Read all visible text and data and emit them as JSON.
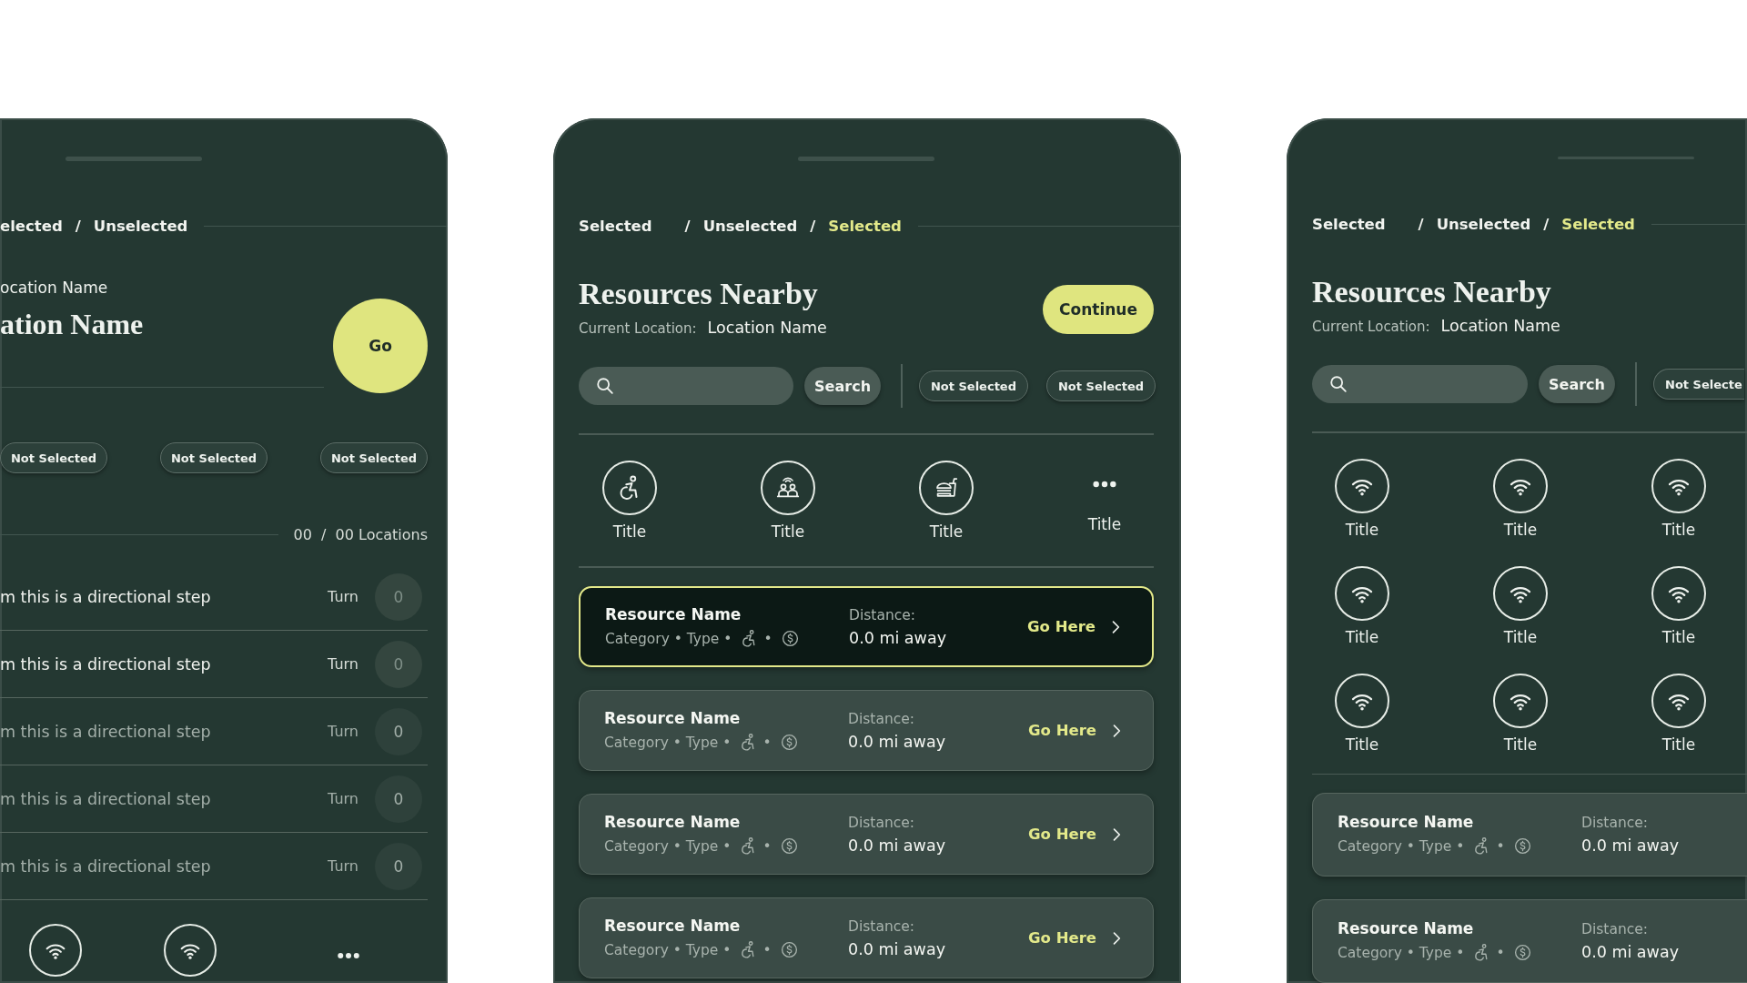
{
  "screens": [
    {
      "kind": "directions",
      "breadcrumb": [
        {
          "kind": "crumb",
          "label": "elected",
          "selected": false
        },
        {
          "kind": "separator",
          "label": "/"
        },
        {
          "kind": "crumb",
          "label": "Unselected",
          "selected": false
        }
      ],
      "location_label": "ocation Name",
      "title": "ation Name",
      "go_button": "Go",
      "filters": [
        {
          "label": "Not Selected",
          "selected": false
        },
        {
          "label": "Not Selected",
          "selected": false
        },
        {
          "label": "Not Selected",
          "selected": false
        }
      ],
      "counter": "00  /  00 Locations",
      "steps": [
        {
          "text": "m this is a directional step",
          "action": "Turn",
          "badge": "0",
          "faded": false
        },
        {
          "text": "m this is a directional step",
          "action": "Turn",
          "badge": "0",
          "faded": false
        },
        {
          "text": "m this is a directional step",
          "action": "Turn",
          "badge": "0",
          "faded": true
        },
        {
          "text": "m this is a directional step",
          "action": "Turn",
          "badge": "0",
          "faded": true
        },
        {
          "text": "m this is a directional step",
          "action": "Turn",
          "badge": "0",
          "faded": true
        }
      ],
      "bottom_nav": [
        {
          "kind": "wifi"
        },
        {
          "kind": "wifi"
        },
        {
          "kind": "more"
        }
      ]
    },
    {
      "kind": "resources",
      "breadcrumb": [
        {
          "kind": "crumb",
          "label": "Selected",
          "selected": false
        },
        {
          "kind": "separator",
          "label": "/"
        },
        {
          "kind": "crumb",
          "label": "Unselected",
          "selected": false
        },
        {
          "kind": "separator",
          "label": "/"
        },
        {
          "kind": "crumb",
          "label": "Selected",
          "selected": true
        }
      ],
      "title": "Resources Nearby",
      "location": {
        "label": "Current Location:",
        "value": "Location Name"
      },
      "continue_button": "Continue",
      "search_button": "Search",
      "filters": [
        {
          "label": "Not Selected",
          "selected": false
        },
        {
          "label": "Not Selected",
          "selected": false
        }
      ],
      "categories": [
        {
          "kind": "wheelchair",
          "label": "Title"
        },
        {
          "kind": "people",
          "label": "Title"
        },
        {
          "kind": "food",
          "label": "Title"
        },
        {
          "kind": "more",
          "label": "Title"
        }
      ],
      "resources": [
        {
          "name": "Resource Name",
          "meta": "Category • Type •",
          "separator": "•",
          "distance_label": "Distance:",
          "distance": "0.0 mi away",
          "action": "Go Here",
          "selected": true
        },
        {
          "name": "Resource Name",
          "meta": "Category • Type •",
          "separator": "•",
          "distance_label": "Distance:",
          "distance": "0.0 mi away",
          "action": "Go Here",
          "selected": false
        },
        {
          "name": "Resource Name",
          "meta": "Category • Type •",
          "separator": "•",
          "distance_label": "Distance:",
          "distance": "0.0 mi away",
          "action": "Go Here",
          "selected": false
        },
        {
          "name": "Resource Name",
          "meta": "Category • Type •",
          "separator": "•",
          "distance_label": "Distance:",
          "distance": "0.0 mi away",
          "action": "Go Here",
          "selected": false
        }
      ]
    },
    {
      "kind": "resources",
      "breadcrumb": [
        {
          "kind": "crumb",
          "label": "Selected",
          "selected": false
        },
        {
          "kind": "separator",
          "label": "/"
        },
        {
          "kind": "crumb",
          "label": "Unselected",
          "selected": false
        },
        {
          "kind": "separator",
          "label": "/"
        },
        {
          "kind": "crumb",
          "label": "Selected",
          "selected": true
        }
      ],
      "title": "Resources Nearby",
      "location": {
        "label": "Current Location:",
        "value": "Location Name"
      },
      "search_button": "Search",
      "filters": [
        {
          "label": "Not Selecte",
          "selected": false
        }
      ],
      "categories": [
        {
          "kind": "wifi",
          "label": "Title"
        },
        {
          "kind": "wifi",
          "label": "Title"
        },
        {
          "kind": "wifi",
          "label": "Title"
        },
        {
          "kind": "wifi",
          "label": "Title"
        },
        {
          "kind": "wifi",
          "label": "Title"
        },
        {
          "kind": "wifi",
          "label": "Title"
        },
        {
          "kind": "wifi",
          "label": "Title"
        },
        {
          "kind": "wifi",
          "label": "Title"
        },
        {
          "kind": "wifi",
          "label": "Title"
        }
      ],
      "resources": [
        {
          "name": "Resource Name",
          "meta": "Category • Type •",
          "separator": "•",
          "distance_label": "Distance:",
          "distance": "0.0 mi away",
          "selected": false
        },
        {
          "name": "Resource Name",
          "meta": "Category • Type •",
          "separator": "•",
          "distance_label": "Distance:",
          "distance": "0.0 mi away",
          "selected": false
        }
      ]
    }
  ]
}
